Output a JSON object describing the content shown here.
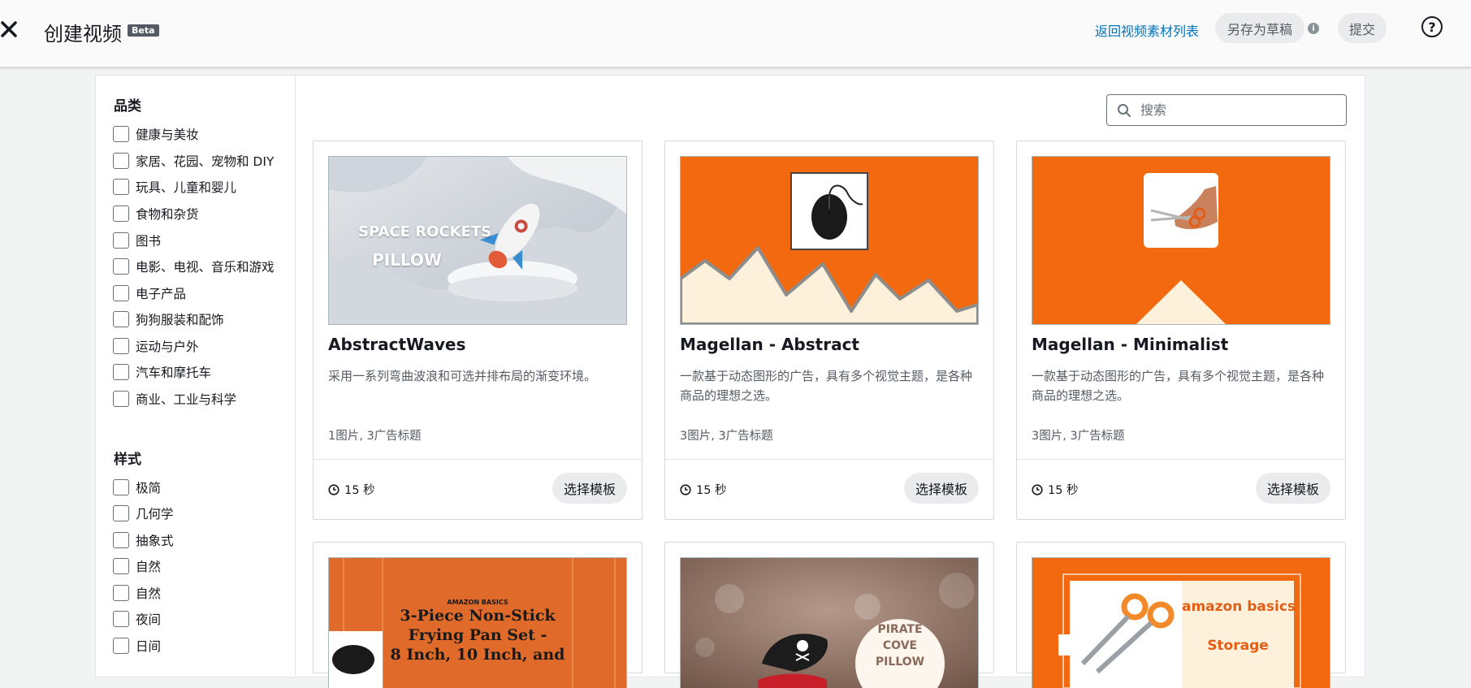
{
  "header": {
    "title": "创建视频",
    "badge": "Beta",
    "back_link": "返回视频素材列表",
    "save_draft": "另存为草稿",
    "info": "i",
    "submit": "提交",
    "help": "?"
  },
  "filters": {
    "category_title": "品类",
    "categories": [
      "健康与美妆",
      "家居、花园、宠物和 DIY",
      "玩具、儿童和婴儿",
      "食物和杂货",
      "图书",
      "电影、电视、音乐和游戏",
      "电子产品",
      "狗狗服装和配饰",
      "运动与户外",
      "汽车和摩托车",
      "商业、工业与科学"
    ],
    "style_title": "样式",
    "styles": [
      "极简",
      "几何学",
      "抽象式",
      "自然",
      "自然",
      "夜间",
      "日间"
    ]
  },
  "search": {
    "placeholder": "搜索"
  },
  "cards": [
    {
      "title": "AbstractWaves",
      "desc": "采用一系列弯曲波浪和可选并排布局的渐变环境。",
      "meta": "1图片, 3广告标题",
      "duration": "15 秒",
      "button": "选择模板",
      "thumb_text": [
        "SPACE ROCKETS",
        "PILLOW"
      ]
    },
    {
      "title": "Magellan - Abstract",
      "desc": "一款基于动态图形的广告，具有多个视觉主题，是各种商品的理想之选。",
      "meta": "3图片, 3广告标题",
      "duration": "15 秒",
      "button": "选择模板"
    },
    {
      "title": "Magellan - Minimalist",
      "desc": "一款基于动态图形的广告，具有多个视觉主题，是各种商品的理想之选。",
      "meta": "3图片, 3广告标题",
      "duration": "15 秒",
      "button": "选择模板"
    },
    {
      "thumb_text": [
        "AMAZON BASICS",
        "3-Piece Non-Stick",
        "Frying Pan Set -",
        "8 Inch, 10 Inch, and"
      ]
    },
    {
      "thumb_text": [
        "PIRATE",
        "COVE",
        "PILLOW"
      ]
    },
    {
      "thumb_text": [
        "amazon basics",
        "Storage"
      ]
    }
  ],
  "colors": {
    "accent_orange": "#f3690f",
    "link_blue": "#0073bb",
    "cream": "#fdf1dc"
  }
}
